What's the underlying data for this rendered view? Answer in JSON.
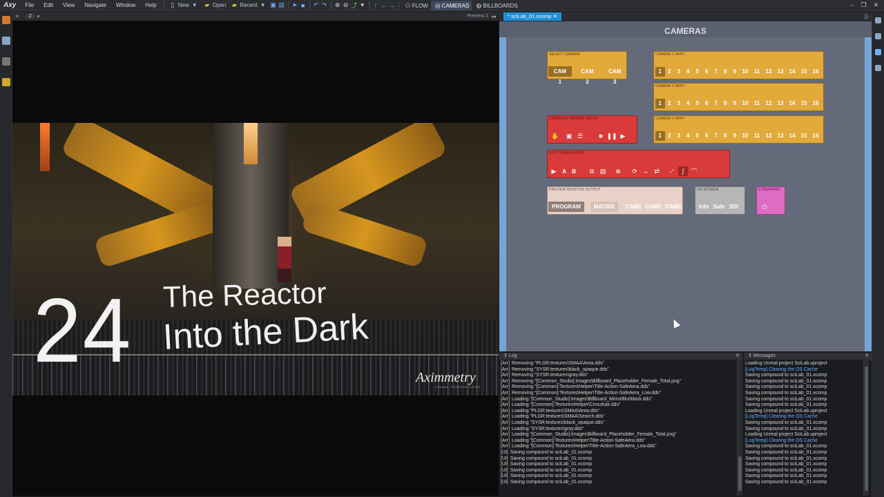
{
  "menubar": {
    "logo": "Axy",
    "menus": [
      "File",
      "Edit",
      "View",
      "Navigate",
      "Window",
      "Help"
    ],
    "new_label": "New",
    "open_label": "Open",
    "recent_label": "Recent",
    "tabs": [
      "FLOW",
      "CAMERAS",
      "BILLBOARDS"
    ],
    "active_tab": "CAMERAS"
  },
  "preview": {
    "layout_num": "2",
    "label": "Preview 2",
    "title_number": "24",
    "title_line1": "The Reactor",
    "title_line2": "Into the Dark",
    "brand": "Aximmetry",
    "brand_sub": "VISUAL TECHNOLOGIES"
  },
  "compound": {
    "tab": "* sciLab_01.xcomp",
    "title": "CAMERAS",
    "select_camera": {
      "title": "SELECT CAMERA",
      "buttons": [
        "CAM 1",
        "CAM 2",
        "CAM 3"
      ],
      "selected": "CAM 1"
    },
    "paths": [
      {
        "title": "CAMERA 1 PATH",
        "selected": "1"
      },
      {
        "title": "CAMERA 2 PATH",
        "selected": "1"
      },
      {
        "title": "CAMERA 3 PATH",
        "selected": "1"
      }
    ],
    "path_numbers": [
      "1",
      "2",
      "3",
      "4",
      "5",
      "6",
      "7",
      "8",
      "9",
      "10",
      "11",
      "12",
      "13",
      "14",
      "15",
      "16"
    ],
    "setup": {
      "title": "CAMERA & RENDER SETUP"
    },
    "edit": {
      "title": "EDIT CAMERA PATH",
      "a": "A",
      "b": "B"
    },
    "monitor": {
      "title": "PREVIEW MONITOR OUTPUT",
      "buttons": [
        "PROGRAM",
        "MATRIX",
        "CAM1",
        "CAM2",
        "CAM3"
      ],
      "selected": "PROGRAM"
    },
    "onscreen": {
      "title": "ON SCREEN",
      "buttons": [
        "Info",
        "Safe",
        "SDI"
      ]
    },
    "streaming": {
      "title": "STREAMING"
    }
  },
  "log": {
    "title": "Log",
    "lines": [
      {
        "tag": "[Arr]",
        "text": "Removing \"PLGR:textures\\SMAA\\Area.dds\""
      },
      {
        "tag": "[Arr]",
        "text": "Removing \"SYSR:textures\\black_opaque.dds\""
      },
      {
        "tag": "[Arr]",
        "text": "Removing \"SYSR:textures\\gray.dds\""
      },
      {
        "tag": "[Arr]",
        "text": "Removing \"[Common_Studio]:Images\\Billboard_Placeholder_Female_Total.png\""
      },
      {
        "tag": "[Arr]",
        "text": "Removing \"[Common]:Textures\\Helper\\Title-Action-SafeAera.dds\""
      },
      {
        "tag": "[Arr]",
        "text": "Removing \"[Common]:Textures\\Helper\\Title-Action-SafeAera_Low.dds\""
      },
      {
        "tag": "[Arr]",
        "text": "Loading \"[Common_Studio]:Images\\Billboard_MirrorBlurMask.dds\""
      },
      {
        "tag": "[Arr]",
        "text": "Loading \"[Common]:Textures\\Helper\\Crosshair.dds\""
      },
      {
        "tag": "[Arr]",
        "text": "Loading \"PLGR:textures\\SMAA\\Area.dds\""
      },
      {
        "tag": "[Arr]",
        "text": "Loading \"PLGR:textures\\SMAA\\Search.dds\""
      },
      {
        "tag": "[Arr]",
        "text": "Loading \"SYSR:textures\\black_opaque.dds\""
      },
      {
        "tag": "[Arr]",
        "text": "Loading \"SYSR:textures\\gray.dds\""
      },
      {
        "tag": "[Arr]",
        "text": "Loading \"[Common_Studio]:Images\\Billboard_Placeholder_Female_Total.png\""
      },
      {
        "tag": "[Arr]",
        "text": "Loading \"[Common]:Textures\\Helper\\Title-Action-SafeAera.dds\""
      },
      {
        "tag": "[Arr]",
        "text": "Loading \"[Common]:Textures\\Helper\\Title-Action-SafeAera_Low.dds\""
      },
      {
        "tag": "[UI]",
        "text": "Saving compound to sciLab_01.xcomp"
      },
      {
        "tag": "[UI]",
        "text": "Saving compound to sciLab_01.xcomp"
      },
      {
        "tag": "[UI]",
        "text": "Saving compound to sciLab_01.xcomp"
      },
      {
        "tag": "[UI]",
        "text": "Saving compound to sciLab_01.xcomp"
      },
      {
        "tag": "[UI]",
        "text": "Saving compound to sciLab_01.xcomp"
      },
      {
        "tag": "[UI]",
        "text": "Saving compound to sciLab_01.xcomp"
      }
    ]
  },
  "messages": {
    "title": "Messages",
    "lines": [
      {
        "text": "Loading Unreal project SciLab.uproject",
        "blue": false
      },
      {
        "text": "[LogTemp] Clearing the OS Cache",
        "blue": true
      },
      {
        "text": "Saving compound to sciLab_01.xcomp",
        "blue": false
      },
      {
        "text": "Saving compound to sciLab_01.xcomp",
        "blue": false
      },
      {
        "text": "Saving compound to sciLab_01.xcomp",
        "blue": false
      },
      {
        "text": "Saving compound to sciLab_01.xcomp",
        "blue": false
      },
      {
        "text": "Saving compound to sciLab_01.xcomp",
        "blue": false
      },
      {
        "text": "Saving compound to sciLab_01.xcomp",
        "blue": false
      },
      {
        "text": "Loading Unreal project SciLab.uproject",
        "blue": false
      },
      {
        "text": "[LogTemp] Clearing the OS Cache",
        "blue": true
      },
      {
        "text": "Saving compound to sciLab_01.xcomp",
        "blue": false
      },
      {
        "text": "Saving compound to sciLab_01.xcomp",
        "blue": false
      },
      {
        "text": "Loading Unreal project SciLab.uproject",
        "blue": false
      },
      {
        "text": "[LogTemp] Clearing the OS Cache",
        "blue": true
      },
      {
        "text": "Saving compound to sciLab_01.xcomp",
        "blue": false
      },
      {
        "text": "Saving compound to sciLab_01.xcomp",
        "blue": false
      },
      {
        "text": "Saving compound to sciLab_01.xcomp",
        "blue": false
      },
      {
        "text": "Saving compound to sciLab_01.xcomp",
        "blue": false
      },
      {
        "text": "Saving compound to sciLab_01.xcomp",
        "blue": false
      },
      {
        "text": "Saving compound to sciLab_01.xcomp",
        "blue": false
      },
      {
        "text": "Saving compound to sciLab_01.xcomp",
        "blue": false
      }
    ]
  },
  "colors": {
    "accent": "#1e8fd6",
    "orange": "#e2a93b",
    "red": "#d93a3a",
    "pink": "#dd6cc3",
    "link": "#66aaff"
  }
}
